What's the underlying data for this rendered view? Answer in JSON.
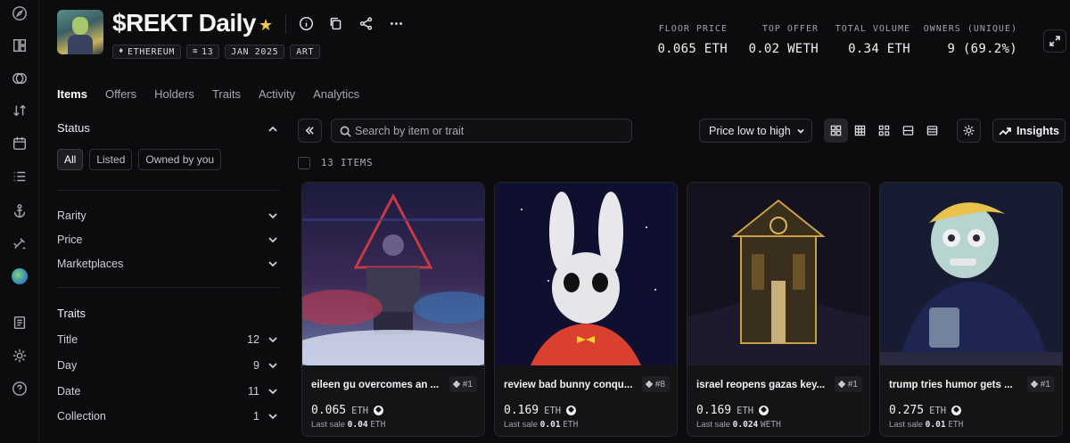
{
  "collection": {
    "title": "$REKT Daily",
    "tags": [
      {
        "icon": "ethereum-icon",
        "label": "ETHEREUM"
      },
      {
        "icon": "layers-icon",
        "label": "13"
      },
      {
        "icon": "",
        "label": "JAN 2025"
      },
      {
        "icon": "",
        "label": "ART"
      }
    ]
  },
  "stats": [
    {
      "label": "FLOOR PRICE",
      "value": "0.065 ETH"
    },
    {
      "label": "TOP OFFER",
      "value": "0.02 WETH"
    },
    {
      "label": "TOTAL VOLUME",
      "value": "0.34 ETH"
    },
    {
      "label": "OWNERS (UNIQUE)",
      "value": "9 (69.2%)"
    }
  ],
  "tabs": [
    "Items",
    "Offers",
    "Holders",
    "Traits",
    "Activity",
    "Analytics"
  ],
  "filters": {
    "status_title": "Status",
    "status_options": [
      "All",
      "Listed",
      "Owned by you"
    ],
    "groups": [
      "Rarity",
      "Price",
      "Marketplaces"
    ],
    "traits_title": "Traits",
    "traits": [
      {
        "name": "Title",
        "count": "12"
      },
      {
        "name": "Day",
        "count": "9"
      },
      {
        "name": "Date",
        "count": "11"
      },
      {
        "name": "Collection",
        "count": "1"
      }
    ]
  },
  "toolbar": {
    "search_placeholder": "Search by item or trait",
    "sort_label": "Price low to high",
    "insights_label": "Insights"
  },
  "items_count": "13 ITEMS",
  "items": [
    {
      "name": "eileen gu overcomes an ...",
      "rank": "#1",
      "price": "0.065",
      "currency": "ETH",
      "last_label": "Last sale",
      "last_value": "0.04",
      "last_currency": "ETH"
    },
    {
      "name": "review bad bunny conqu...",
      "rank": "#8",
      "price": "0.169",
      "currency": "ETH",
      "last_label": "Last sale",
      "last_value": "0.01",
      "last_currency": "ETH"
    },
    {
      "name": "israel reopens gazas key...",
      "rank": "#1",
      "price": "0.169",
      "currency": "ETH",
      "last_label": "Last sale",
      "last_value": "0.024",
      "last_currency": "WETH"
    },
    {
      "name": "trump tries humor gets ...",
      "rank": "#1",
      "price": "0.275",
      "currency": "ETH",
      "last_label": "Last sale",
      "last_value": "0.01",
      "last_currency": "ETH"
    }
  ]
}
